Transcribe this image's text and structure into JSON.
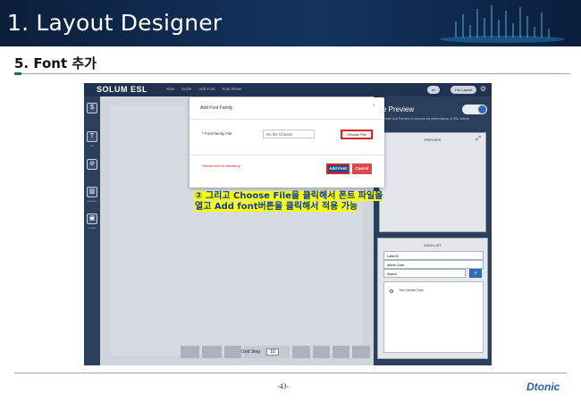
{
  "banner": {
    "title": "1. Layout Designer"
  },
  "section": {
    "title": "5. Font 추가"
  },
  "app": {
    "logo": "SOLUM ESL",
    "menu": [
      "New",
      "Scale",
      "Add Font",
      "Font Reset"
    ],
    "pill_left": "en",
    "pill_right": "Hot Layout",
    "sidebar_labels": [
      "text",
      "barcode",
      "image"
    ],
    "grid_step_label": "Grid Step",
    "grid_step_value": "10",
    "live_preview_title": "ve Preview",
    "live_preview_note": "we render Live Preview to improve the performance of ESL editing",
    "preview_header": "PREVIEW",
    "data_list_header": "DATA LIST",
    "data_select_1": "Label ID",
    "data_select_2": "Article Code",
    "search_placeholder": "Search",
    "sample_data": "Test Sample Data"
  },
  "modal": {
    "title": "Add Font Family",
    "close": "×",
    "field_label": "* Font family File",
    "file_value": "No file Chosen",
    "choose_label": "Choose File",
    "mandatory_note": "*Marked field is mandatory",
    "add_label": "Add Font",
    "cancel_label": "Cancel"
  },
  "annotation": {
    "line1": "② 그리고 Choose File을 클릭해서 폰트 파일을",
    "line2": "열고 Add font버튼을 클릭해서 적용 가능"
  },
  "footer": {
    "page": "-43-",
    "brand": "Dtonic"
  }
}
